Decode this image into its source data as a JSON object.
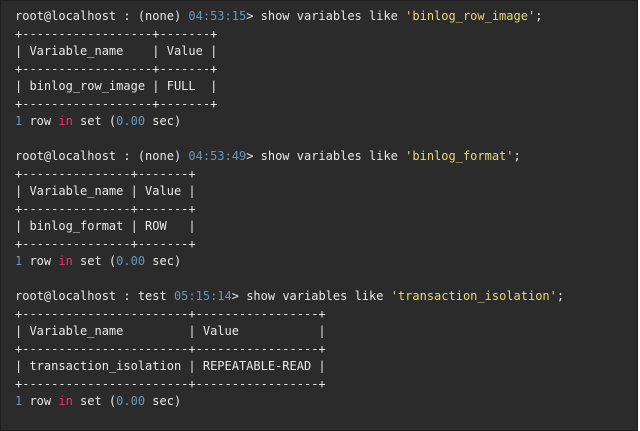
{
  "colors": {
    "background": "#2b2b2b",
    "text": "#e9e9e9",
    "time": "#6897bb",
    "string": "#e6db74",
    "number": "#6897bb",
    "keyword": "#f92672"
  },
  "blocks": [
    {
      "prompt": "root@localhost : (none) ",
      "time": "04:53:15",
      "command_prefix": "> show variables like ",
      "command_string": "'binlog_row_image'",
      "command_suffix": ";",
      "table_lines": [
        "+------------------+-------+",
        "| Variable_name    | Value |",
        "+------------------+-------+",
        "| binlog_row_image | FULL  |",
        "+------------------+-------+"
      ],
      "result": {
        "count": "1",
        "row": " row ",
        "in": "in",
        "set": " set (",
        "secs": "0.00",
        "suffix": " sec)"
      }
    },
    {
      "prompt": "root@localhost : (none) ",
      "time": "04:53:49",
      "command_prefix": "> show variables like ",
      "command_string": "'binlog_format'",
      "command_suffix": ";",
      "table_lines": [
        "+---------------+-------+",
        "| Variable_name | Value |",
        "+---------------+-------+",
        "| binlog_format | ROW   |",
        "+---------------+-------+"
      ],
      "result": {
        "count": "1",
        "row": " row ",
        "in": "in",
        "set": " set (",
        "secs": "0.00",
        "suffix": " sec)"
      }
    },
    {
      "prompt": "root@localhost : test ",
      "time": "05:15:14",
      "command_prefix": "> show variables like ",
      "command_string": "'transaction_isolation'",
      "command_suffix": ";",
      "table_lines": [
        "+-----------------------+-----------------+",
        "| Variable_name         | Value           |",
        "+-----------------------+-----------------+",
        "| transaction_isolation | REPEATABLE-READ |",
        "+-----------------------+-----------------+"
      ],
      "result": {
        "count": "1",
        "row": " row ",
        "in": "in",
        "set": " set (",
        "secs": "0.00",
        "suffix": " sec)"
      }
    }
  ]
}
